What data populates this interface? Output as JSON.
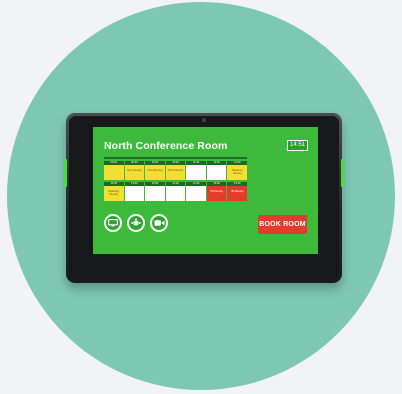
{
  "room": {
    "title": "North Conference Room",
    "clock": "14:51"
  },
  "schedule": {
    "rows": [
      {
        "cells": [
          {
            "time": "09:00",
            "label": "",
            "status": "yellow"
          },
          {
            "time": "09:30",
            "label": "Team Meeting",
            "status": "yellow"
          },
          {
            "time": "10:00",
            "label": "Client Meeting",
            "status": "yellow"
          },
          {
            "time": "10:30",
            "label": "Client Meeting",
            "status": "yellow"
          },
          {
            "time": "11:00",
            "label": "",
            "status": "free"
          },
          {
            "time": "11:30",
            "label": "",
            "status": "free"
          },
          {
            "time": "12:00",
            "label": "Marketing Meeting",
            "status": "yellow"
          }
        ]
      },
      {
        "cells": [
          {
            "time": "12:30",
            "label": "Marketing Meeting",
            "status": "yellow"
          },
          {
            "time": "13:00",
            "label": "",
            "status": "free"
          },
          {
            "time": "13:30",
            "label": "",
            "status": "free"
          },
          {
            "time": "14:00",
            "label": "",
            "status": "free"
          },
          {
            "time": "14:30",
            "label": "",
            "status": "free"
          },
          {
            "time": "15:00",
            "label": "HR Meeting",
            "status": "red"
          },
          {
            "time": "15:30",
            "label": "HR Meeting",
            "status": "red"
          }
        ]
      }
    ]
  },
  "amenities": [
    {
      "icon": "display-icon"
    },
    {
      "icon": "conference-call-icon"
    },
    {
      "icon": "video-camera-icon"
    }
  ],
  "actions": {
    "book_label": "BOOK ROOM"
  },
  "colors": {
    "screen": "#3dba3c",
    "booked": "#f3df33",
    "busy": "#e53b2c",
    "header_strip": "#1d6a22",
    "backdrop_circle": "#7ec8b2"
  }
}
